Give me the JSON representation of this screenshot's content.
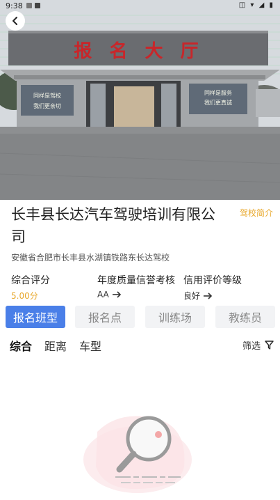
{
  "status_bar": {
    "time": "9:38"
  },
  "hero": {
    "sign_text": "报 名 大 厅",
    "left_poster": "同样是驾校 我们更亲切",
    "right_poster": "同样是服务 我们更真诚"
  },
  "school": {
    "name": "长丰县长达汽车驾驶培训有限公司",
    "intro_link": "驾校简介",
    "address": "安徽省合肥市长丰县水湖镇铁路东长达驾校"
  },
  "stats": [
    {
      "label": "综合评分",
      "value": "5.00分"
    },
    {
      "label": "年度质量信誉考核",
      "value": "AA"
    },
    {
      "label": "信用评价等级",
      "value": "良好"
    }
  ],
  "tabs": [
    "报名班型",
    "报名点",
    "训练场",
    "教练员"
  ],
  "sort": {
    "items": [
      "综合",
      "距离",
      "车型"
    ],
    "filter_label": "筛选"
  },
  "colors": {
    "accent": "#4a7fe8",
    "score": "#e8a82c"
  }
}
